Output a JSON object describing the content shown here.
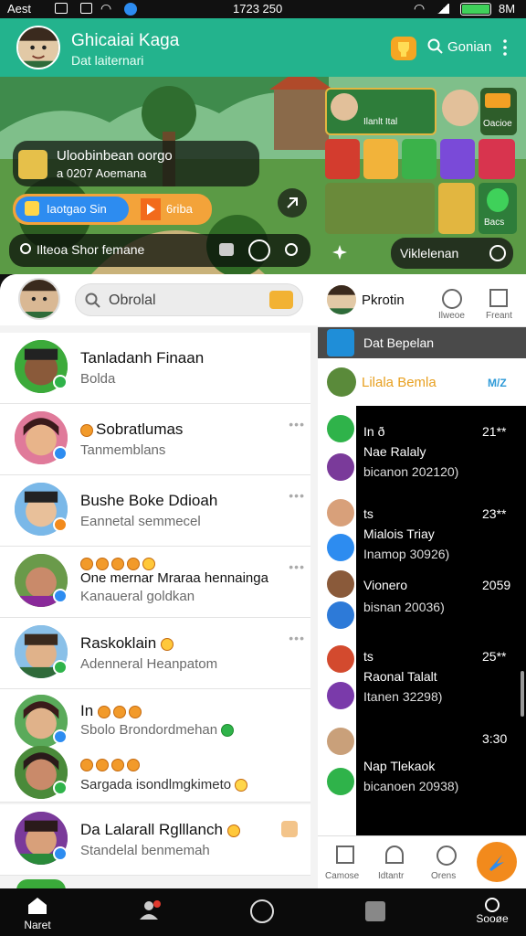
{
  "status": {
    "left": "Aest",
    "time": "1723 250",
    "right": "8M"
  },
  "header": {
    "title": "Ghicaiai Kaga",
    "subtitle": "Dat laiternari",
    "search_label": "Gonian"
  },
  "hero": {
    "promo_title": "Uloobinbean oorgo",
    "promo_sub": "a 0207 Aoemana",
    "chip1": "Iaotgao Sin",
    "chip2": "6riba",
    "bottom_left": "Ilteoa Shor femane",
    "bottom_right": "Viklelenan",
    "tiles": [
      "Ilanlt Ital",
      "Oacioe",
      "Bacs"
    ]
  },
  "search": {
    "placeholder": "Obrolal"
  },
  "chats": [
    {
      "name": "Tanladanh Finaan",
      "sub": "Bolda"
    },
    {
      "name": "Sobratlumas",
      "sub": "Tanmemblans"
    },
    {
      "name": "Bushe Boke Ddioah",
      "sub": "Eannetal semmecel"
    },
    {
      "name": "One mernar Mraraa hennainga",
      "sub": "Kanaueral goldkan"
    },
    {
      "name": "Raskoklain",
      "sub": "Adenneral Heanpatom"
    },
    {
      "name": "In",
      "sub": "Sbolo Brondordmehan",
      "name2": "Sargada isondlmgkimeto"
    },
    {
      "name": "Da Lalarall Rglllanch",
      "sub": "Standelal benmemah"
    }
  ],
  "right_panel": {
    "profile_name": "Pkrotin",
    "icon1": "Ilweoe",
    "icon2": "Freant",
    "banner": "Dat Bepelan",
    "highlight": "Lilala Bemla",
    "highlight_tag": "M/Z",
    "items": [
      {
        "line1": "In ð",
        "line2": "Nae Ralaly",
        "line3": "bicanon 202120)",
        "val": "21**"
      },
      {
        "line1": "ts",
        "line2": "Mialois Triay",
        "line3": "Inamop 30926)",
        "val": "23**"
      },
      {
        "line1": "Vionero",
        "line2": "",
        "line3": "bisnan 20036)",
        "val": "2059"
      },
      {
        "line1": "ts",
        "line2": "Raonal Talalt",
        "line3": "Itanen 32298)",
        "val": "25**"
      },
      {
        "line1": "",
        "line2": "Nap Tlekaok",
        "line3": "bicanoen 20938)",
        "val": "3:30"
      }
    ],
    "tabs": [
      "Camose",
      "Idtantr",
      "Orens"
    ]
  },
  "bottom_nav": {
    "home": "Naret",
    "settings": "Sooøe"
  },
  "colors": {
    "accent": "#23b38d",
    "orange": "#f28a1c",
    "blue": "#2d8cf0",
    "green": "#34b34a"
  }
}
